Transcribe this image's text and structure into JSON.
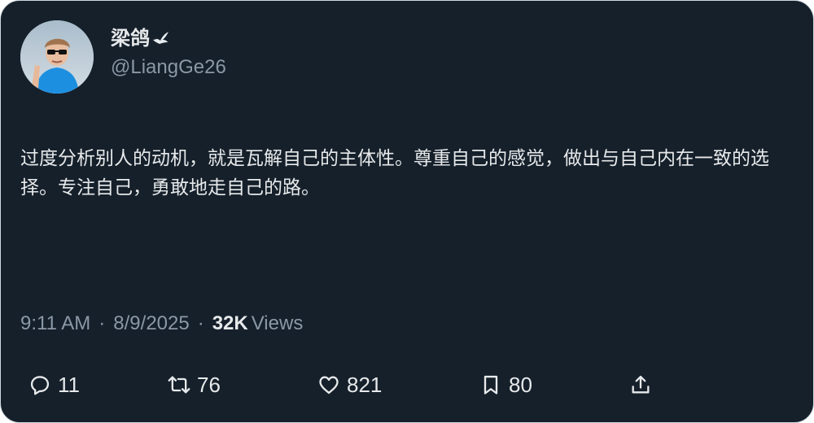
{
  "author": {
    "name": "梁鸽",
    "handle": "@LiangGe26",
    "avatar_icon": "profile-photo-icon",
    "name_badge_icon": "dove-icon"
  },
  "tweet": {
    "text": "过度分析别人的动机，就是瓦解自己的主体性。尊重自己的感觉，做出与自己内在一致的选择。专注自己，勇敢地走自己的路。",
    "time": "9:11 AM",
    "date": "8/9/2025",
    "separator": "·",
    "views_count": "32K",
    "views_label": "Views"
  },
  "actions": {
    "reply": {
      "icon": "reply-icon",
      "count": "11"
    },
    "retweet": {
      "icon": "retweet-icon",
      "count": "76"
    },
    "like": {
      "icon": "heart-icon",
      "count": "821"
    },
    "bookmark": {
      "icon": "bookmark-icon",
      "count": "80"
    },
    "share": {
      "icon": "share-icon"
    }
  },
  "colors": {
    "background": "#15202b",
    "primary_text": "#e7e9ea",
    "secondary_text": "#8b98a5",
    "border": "#cfd9de"
  }
}
